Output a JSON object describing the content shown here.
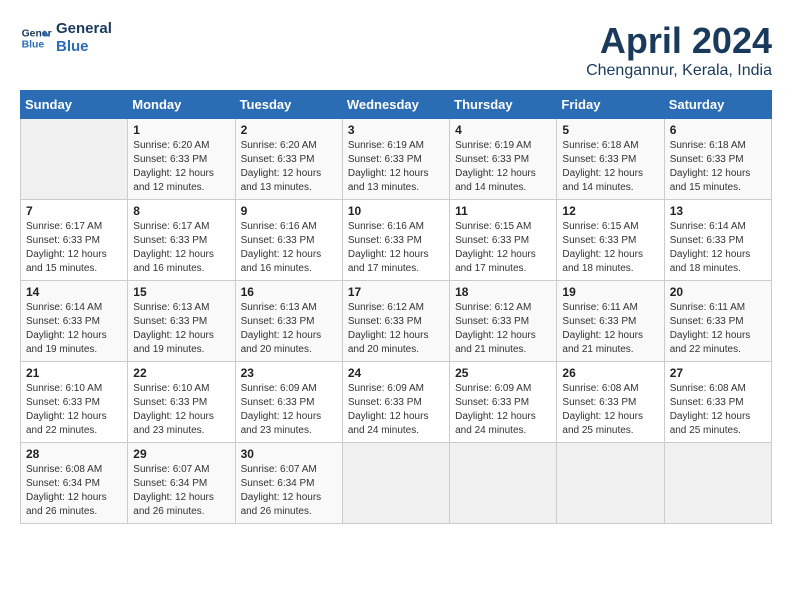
{
  "header": {
    "logo_line1": "General",
    "logo_line2": "Blue",
    "title": "April 2024",
    "subtitle": "Chengannur, Kerala, India"
  },
  "weekdays": [
    "Sunday",
    "Monday",
    "Tuesday",
    "Wednesday",
    "Thursday",
    "Friday",
    "Saturday"
  ],
  "weeks": [
    [
      {
        "day": "",
        "content": ""
      },
      {
        "day": "1",
        "content": "Sunrise: 6:20 AM\nSunset: 6:33 PM\nDaylight: 12 hours\nand 12 minutes."
      },
      {
        "day": "2",
        "content": "Sunrise: 6:20 AM\nSunset: 6:33 PM\nDaylight: 12 hours\nand 13 minutes."
      },
      {
        "day": "3",
        "content": "Sunrise: 6:19 AM\nSunset: 6:33 PM\nDaylight: 12 hours\nand 13 minutes."
      },
      {
        "day": "4",
        "content": "Sunrise: 6:19 AM\nSunset: 6:33 PM\nDaylight: 12 hours\nand 14 minutes."
      },
      {
        "day": "5",
        "content": "Sunrise: 6:18 AM\nSunset: 6:33 PM\nDaylight: 12 hours\nand 14 minutes."
      },
      {
        "day": "6",
        "content": "Sunrise: 6:18 AM\nSunset: 6:33 PM\nDaylight: 12 hours\nand 15 minutes."
      }
    ],
    [
      {
        "day": "7",
        "content": "Sunrise: 6:17 AM\nSunset: 6:33 PM\nDaylight: 12 hours\nand 15 minutes."
      },
      {
        "day": "8",
        "content": "Sunrise: 6:17 AM\nSunset: 6:33 PM\nDaylight: 12 hours\nand 16 minutes."
      },
      {
        "day": "9",
        "content": "Sunrise: 6:16 AM\nSunset: 6:33 PM\nDaylight: 12 hours\nand 16 minutes."
      },
      {
        "day": "10",
        "content": "Sunrise: 6:16 AM\nSunset: 6:33 PM\nDaylight: 12 hours\nand 17 minutes."
      },
      {
        "day": "11",
        "content": "Sunrise: 6:15 AM\nSunset: 6:33 PM\nDaylight: 12 hours\nand 17 minutes."
      },
      {
        "day": "12",
        "content": "Sunrise: 6:15 AM\nSunset: 6:33 PM\nDaylight: 12 hours\nand 18 minutes."
      },
      {
        "day": "13",
        "content": "Sunrise: 6:14 AM\nSunset: 6:33 PM\nDaylight: 12 hours\nand 18 minutes."
      }
    ],
    [
      {
        "day": "14",
        "content": "Sunrise: 6:14 AM\nSunset: 6:33 PM\nDaylight: 12 hours\nand 19 minutes."
      },
      {
        "day": "15",
        "content": "Sunrise: 6:13 AM\nSunset: 6:33 PM\nDaylight: 12 hours\nand 19 minutes."
      },
      {
        "day": "16",
        "content": "Sunrise: 6:13 AM\nSunset: 6:33 PM\nDaylight: 12 hours\nand 20 minutes."
      },
      {
        "day": "17",
        "content": "Sunrise: 6:12 AM\nSunset: 6:33 PM\nDaylight: 12 hours\nand 20 minutes."
      },
      {
        "day": "18",
        "content": "Sunrise: 6:12 AM\nSunset: 6:33 PM\nDaylight: 12 hours\nand 21 minutes."
      },
      {
        "day": "19",
        "content": "Sunrise: 6:11 AM\nSunset: 6:33 PM\nDaylight: 12 hours\nand 21 minutes."
      },
      {
        "day": "20",
        "content": "Sunrise: 6:11 AM\nSunset: 6:33 PM\nDaylight: 12 hours\nand 22 minutes."
      }
    ],
    [
      {
        "day": "21",
        "content": "Sunrise: 6:10 AM\nSunset: 6:33 PM\nDaylight: 12 hours\nand 22 minutes."
      },
      {
        "day": "22",
        "content": "Sunrise: 6:10 AM\nSunset: 6:33 PM\nDaylight: 12 hours\nand 23 minutes."
      },
      {
        "day": "23",
        "content": "Sunrise: 6:09 AM\nSunset: 6:33 PM\nDaylight: 12 hours\nand 23 minutes."
      },
      {
        "day": "24",
        "content": "Sunrise: 6:09 AM\nSunset: 6:33 PM\nDaylight: 12 hours\nand 24 minutes."
      },
      {
        "day": "25",
        "content": "Sunrise: 6:09 AM\nSunset: 6:33 PM\nDaylight: 12 hours\nand 24 minutes."
      },
      {
        "day": "26",
        "content": "Sunrise: 6:08 AM\nSunset: 6:33 PM\nDaylight: 12 hours\nand 25 minutes."
      },
      {
        "day": "27",
        "content": "Sunrise: 6:08 AM\nSunset: 6:33 PM\nDaylight: 12 hours\nand 25 minutes."
      }
    ],
    [
      {
        "day": "28",
        "content": "Sunrise: 6:08 AM\nSunset: 6:34 PM\nDaylight: 12 hours\nand 26 minutes."
      },
      {
        "day": "29",
        "content": "Sunrise: 6:07 AM\nSunset: 6:34 PM\nDaylight: 12 hours\nand 26 minutes."
      },
      {
        "day": "30",
        "content": "Sunrise: 6:07 AM\nSunset: 6:34 PM\nDaylight: 12 hours\nand 26 minutes."
      },
      {
        "day": "",
        "content": ""
      },
      {
        "day": "",
        "content": ""
      },
      {
        "day": "",
        "content": ""
      },
      {
        "day": "",
        "content": ""
      }
    ]
  ]
}
